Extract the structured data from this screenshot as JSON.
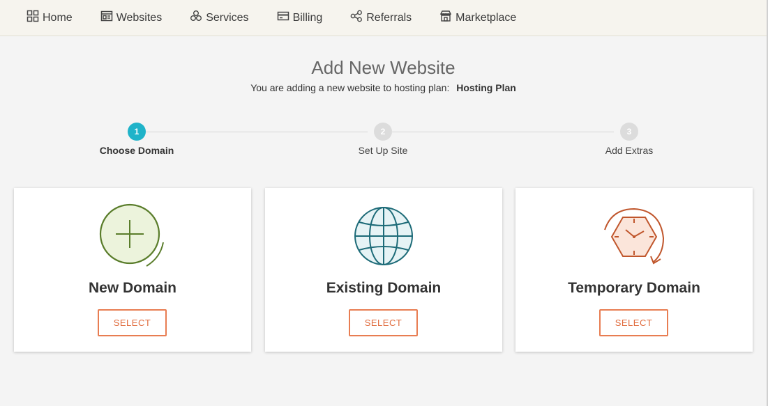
{
  "nav": {
    "items": [
      {
        "label": "Home",
        "icon": "grid-icon"
      },
      {
        "label": "Websites",
        "icon": "website-icon"
      },
      {
        "label": "Services",
        "icon": "services-icon"
      },
      {
        "label": "Billing",
        "icon": "credit-card-icon"
      },
      {
        "label": "Referrals",
        "icon": "share-icon"
      },
      {
        "label": "Marketplace",
        "icon": "store-icon"
      }
    ]
  },
  "header": {
    "title": "Add New Website",
    "subtitle_prefix": "You are adding a new website to hosting plan:",
    "plan_name": "Hosting Plan"
  },
  "stepper": {
    "steps": [
      {
        "number": "1",
        "label": "Choose Domain",
        "state": "active"
      },
      {
        "number": "2",
        "label": "Set Up Site",
        "state": "inactive"
      },
      {
        "number": "3",
        "label": "Add Extras",
        "state": "inactive"
      }
    ]
  },
  "cards": [
    {
      "title": "New Domain",
      "button": "SELECT",
      "icon": "plus-circle-icon"
    },
    {
      "title": "Existing Domain",
      "button": "SELECT",
      "icon": "globe-icon"
    },
    {
      "title": "Temporary Domain",
      "button": "SELECT",
      "icon": "clock-refresh-icon"
    }
  ],
  "colors": {
    "accent": "#1fb3c9",
    "button": "#e87d52",
    "new_domain_icon": "#5a7d2b",
    "existing_domain_icon": "#1d6b78",
    "temporary_domain_icon": "#c0562c"
  }
}
